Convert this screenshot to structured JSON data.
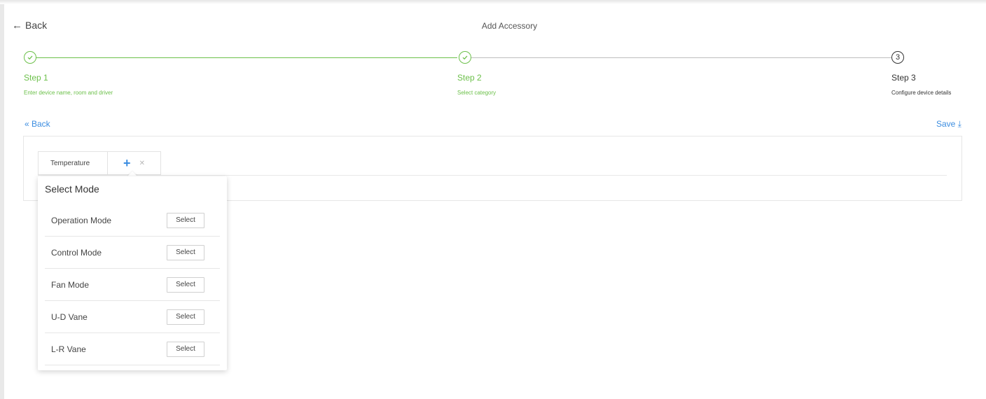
{
  "header": {
    "back_label": "Back",
    "title": "Add Accessory"
  },
  "stepper": {
    "steps": [
      {
        "title": "Step 1",
        "subtitle": "Enter device name, room and driver",
        "state": "done"
      },
      {
        "title": "Step 2",
        "subtitle": "Select category",
        "state": "done"
      },
      {
        "title": "Step 3",
        "subtitle": "Configure device details",
        "state": "active",
        "number": "3"
      }
    ]
  },
  "nav": {
    "back_label": "« Back",
    "save_label": "Save ⤓"
  },
  "tabs": [
    {
      "label": "Temperature"
    }
  ],
  "dropdown": {
    "title": "Select Mode",
    "items": [
      {
        "label": "Operation Mode",
        "button": "Select"
      },
      {
        "label": "Control Mode",
        "button": "Select"
      },
      {
        "label": "Fan Mode",
        "button": "Select"
      },
      {
        "label": "U-D Vane",
        "button": "Select"
      },
      {
        "label": "L-R Vane",
        "button": "Select"
      }
    ]
  },
  "colors": {
    "accent_green": "#6cc04a",
    "link_blue": "#3c8de0"
  }
}
